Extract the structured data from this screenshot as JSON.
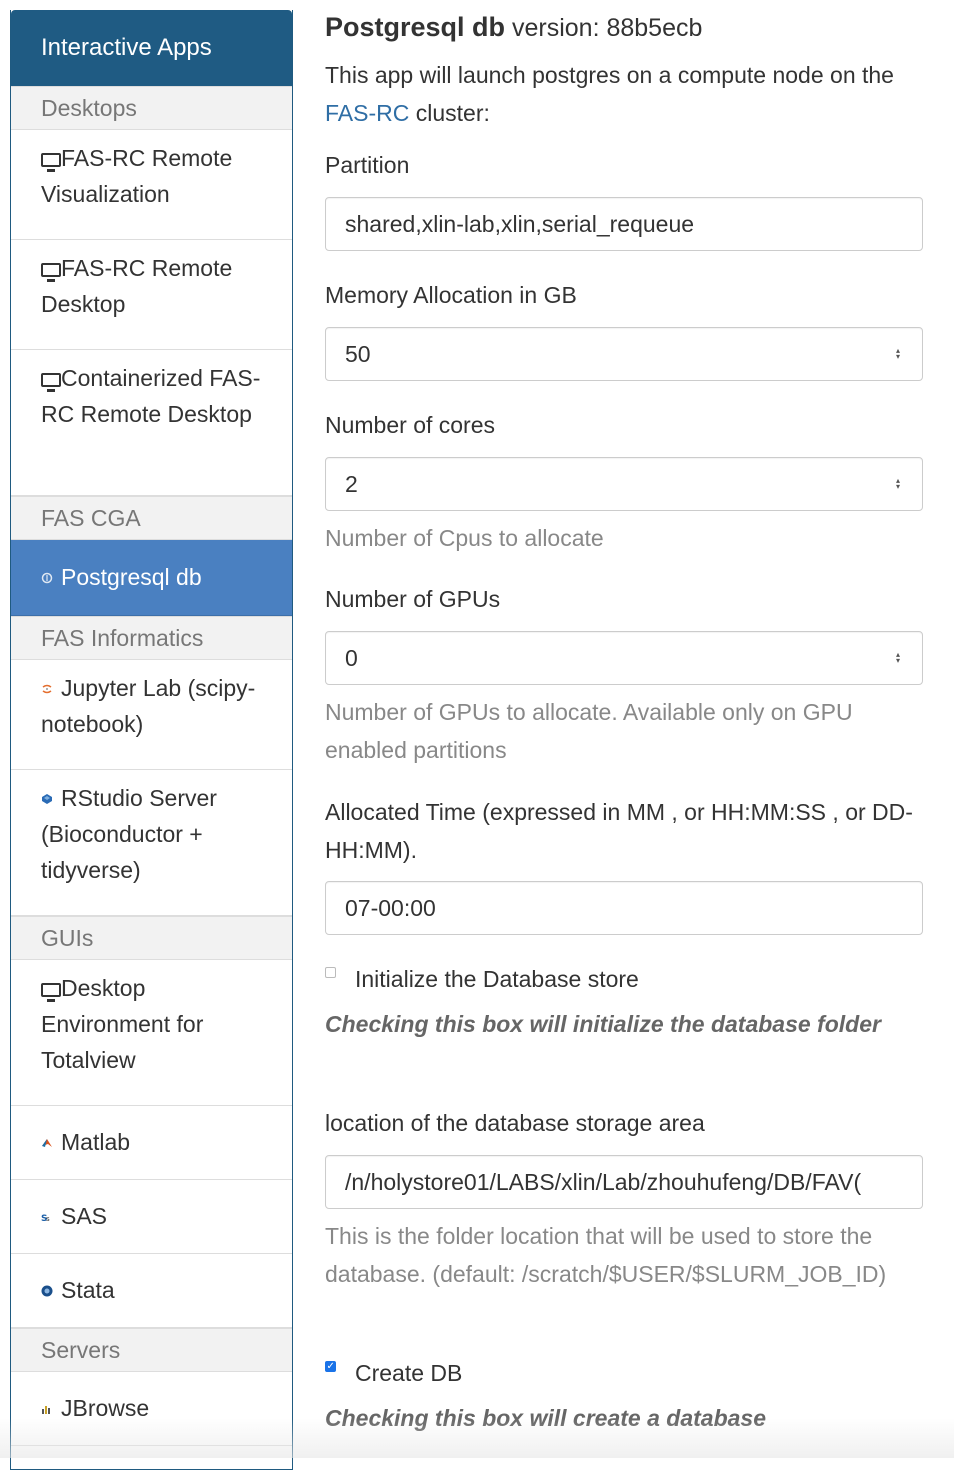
{
  "sidebar": {
    "header": "Interactive Apps",
    "categories": {
      "desktops": "Desktops",
      "fas_cga": "FAS CGA",
      "fas_informatics": "FAS Informatics",
      "guis": "GUIs",
      "servers": "Servers"
    },
    "items": {
      "remote_vis": "FAS-RC Remote Visualization",
      "remote_desktop": "FAS-RC Remote Desktop",
      "containerized": "Containerized FAS-RC Remote Desktop",
      "postgresql": "Postgresql db",
      "jupyter": "Jupyter Lab (scipy-notebook)",
      "rstudio": "RStudio Server (Bioconductor + tidyverse)",
      "totalview": "Desktop Environment for Totalview",
      "matlab": "Matlab",
      "sas": "SAS",
      "stata": "Stata",
      "jbrowse": "JBrowse"
    }
  },
  "form": {
    "title": "Postgresql db",
    "version": "version: 88b5ecb",
    "desc_before": "This app will launch postgres on a compute node on the ",
    "desc_link": "FAS-RC",
    "desc_after": " cluster:",
    "partition_label": "Partition",
    "partition_value": "shared,xlin-lab,xlin,serial_requeue",
    "memory_label": "Memory Allocation in GB",
    "memory_value": "50",
    "cores_label": "Number of cores",
    "cores_value": "2",
    "cores_help": "Number of Cpus to allocate",
    "gpus_label": "Number of GPUs",
    "gpus_value": "0",
    "gpus_help": "Number of GPUs to allocate. Available only on GPU enabled partitions",
    "time_label": "Allocated Time (expressed in MM , or HH:MM:SS , or DD-HH:MM).",
    "time_value": "07-00:00",
    "init_label": "Initialize the Database store",
    "init_help": "Checking this box will initialize the database folder",
    "init_checked": false,
    "location_label": "location of the database storage area",
    "location_value": "/n/holystore01/LABS/xlin/Lab/zhouhufeng/DB/FAV(",
    "location_help": "This is the folder location that will be used to store the database. (default: /scratch/$USER/$SLURM_JOB_ID)",
    "create_label": "Create DB",
    "create_help": "Checking this box will create a database",
    "create_checked": true
  },
  "colors": {
    "header_bg": "#1f5b83",
    "active_bg": "#4a80c1",
    "link": "#2f6ea5"
  }
}
